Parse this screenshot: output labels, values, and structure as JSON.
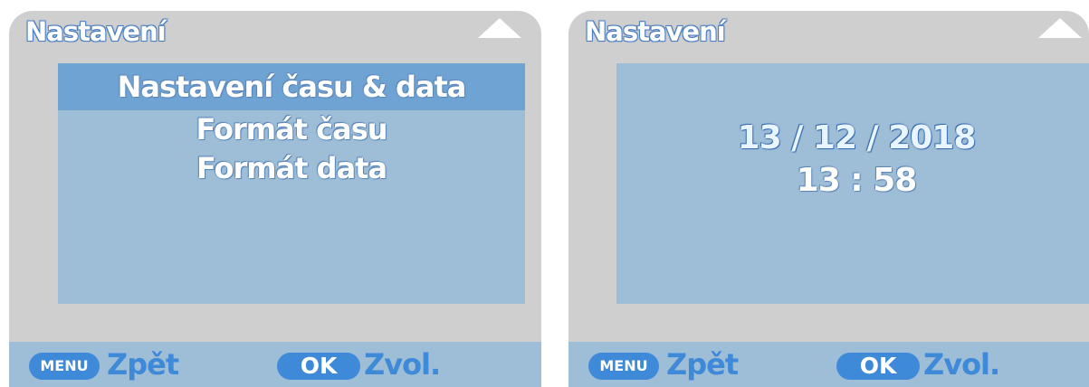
{
  "colors": {
    "panel_bg": "#cfcfcf",
    "content_bg": "#9ebdd6",
    "selected_bg": "#6fa3d4",
    "accent": "#3f8ad8"
  },
  "left_panel": {
    "title": "Nastavení",
    "menu": {
      "items": [
        {
          "label": "Nastavení času & data",
          "selected": true
        },
        {
          "label": "Formát času",
          "selected": false
        },
        {
          "label": "Formát data",
          "selected": false
        }
      ]
    },
    "footer": {
      "menu_button": "MENU",
      "back_label": "Zpět",
      "ok_button": "OK",
      "select_label": "Zvol."
    }
  },
  "right_panel": {
    "title": "Nastavení",
    "date": "13 / 12 / 2018",
    "time": "13 : 58",
    "footer": {
      "menu_button": "MENU",
      "back_label": "Zpět",
      "ok_button": "OK",
      "select_label": "Zvol."
    }
  },
  "icons": {
    "corner": "triangle-up-icon"
  }
}
